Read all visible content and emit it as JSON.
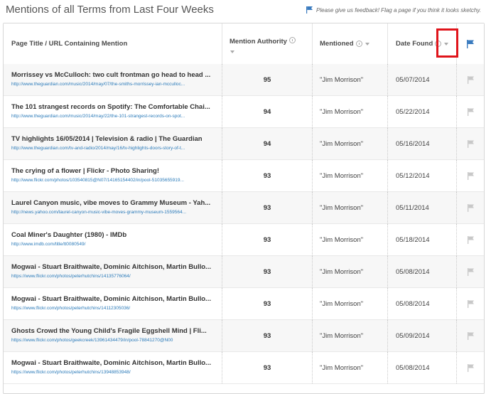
{
  "page": {
    "title": "Mentions of all Terms from Last Four Weeks",
    "feedback": "Please give us feedback! Flag a page if you think it looks sketchy."
  },
  "table": {
    "headers": {
      "page": "Page Title / URL Containing Mention",
      "authority": "Mention Authority",
      "mentioned": "Mentioned",
      "date": "Date Found"
    },
    "rows": [
      {
        "title": "Morrissey vs McCulloch: two cult frontman go head to head ...",
        "url": "http://www.theguardian.com/music/2014/may/07/the-smiths-morrissey-ian-mcculloc...",
        "authority": "95",
        "mentioned": "\"Jim Morrison\"",
        "date": "05/07/2014"
      },
      {
        "title": "The 101 strangest records on Spotify: The Comfortable Chai...",
        "url": "http://www.theguardian.com/music/2014/may/22/the-101-strangest-records-on-spot...",
        "authority": "94",
        "mentioned": "\"Jim Morrison\"",
        "date": "05/22/2014"
      },
      {
        "title": "TV highlights 16/05/2014 | Television & radio | The Guardian",
        "url": "http://www.theguardian.com/tv-and-radio/2014/may/16/tv-highlights-doors-story-of-t...",
        "authority": "94",
        "mentioned": "\"Jim Morrison\"",
        "date": "05/16/2014"
      },
      {
        "title": "The crying of a flower | Flickr - Photo Sharing!",
        "url": "http://www.flickr.com/photos/103540815@N07/14165154402/in/pool-51035655919...",
        "authority": "93",
        "mentioned": "\"Jim Morrison\"",
        "date": "05/12/2014"
      },
      {
        "title": "Laurel Canyon music, vibe moves to Grammy Museum - Yah...",
        "url": "http://news.yahoo.com/laurel-canyon-music-vibe-moves-grammy-museum-1559564...",
        "authority": "93",
        "mentioned": "\"Jim Morrison\"",
        "date": "05/11/2014"
      },
      {
        "title": "Coal Miner's Daughter (1980) - IMDb",
        "url": "http://www.imdb.com/title/tt0080549/",
        "authority": "93",
        "mentioned": "\"Jim Morrison\"",
        "date": "05/18/2014"
      },
      {
        "title": "Mogwai - Stuart Braithwaite, Dominic Aitchison, Martin Bullo...",
        "url": "https://www.flickr.com/photos/peterhutchins/14135776064/",
        "authority": "93",
        "mentioned": "\"Jim Morrison\"",
        "date": "05/08/2014"
      },
      {
        "title": "Mogwai - Stuart Braithwaite, Dominic Aitchison, Martin Bullo...",
        "url": "https://www.flickr.com/photos/peterhutchins/14112305036/",
        "authority": "93",
        "mentioned": "\"Jim Morrison\"",
        "date": "05/08/2014"
      },
      {
        "title": "Ghosts Crowd the Young Child's Fragile Eggshell Mind | Fli...",
        "url": "https://www.flickr.com/photos/geekcreek/13961434479/in/pool-78841270@N00",
        "authority": "93",
        "mentioned": "\"Jim Morrison\"",
        "date": "05/09/2014"
      },
      {
        "title": "Mogwai - Stuart Braithwaite, Dominic Aitchison, Martin Bullo...",
        "url": "https://www.flickr.com/photos/peterhutchins/13948853948/",
        "authority": "93",
        "mentioned": "\"Jim Morrison\"",
        "date": "05/08/2014"
      }
    ]
  },
  "colors": {
    "link": "#2a7ab9",
    "flag_header": "#3a7bbf",
    "flag_row": "#c8c8c8",
    "highlight": "#e0141b"
  },
  "icons": [
    "flag-icon",
    "info-icon",
    "sort-icon"
  ]
}
